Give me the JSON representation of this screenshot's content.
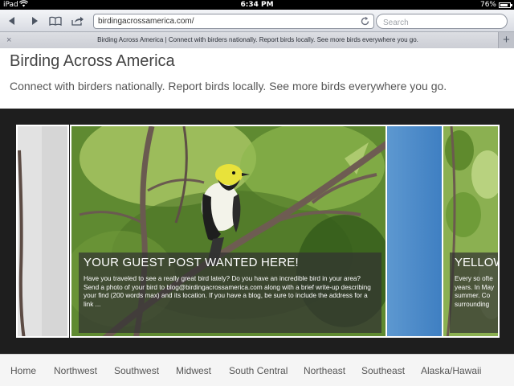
{
  "status_bar": {
    "device": "iPad",
    "time": "6:34 PM",
    "battery": "76%"
  },
  "toolbar": {
    "url": "birdingacrossamerica.com/",
    "search_placeholder": "Search"
  },
  "tab": {
    "title": "Birding Across America | Connect with birders nationally. Report birds locally. See more birds everywhere you go.",
    "close_label": "×",
    "new_tab_label": "+"
  },
  "site": {
    "title": "Birding Across America",
    "tagline": "Connect with birders nationally. Report birds locally. See more birds everywhere you go."
  },
  "slider": {
    "main": {
      "title": "YOUR GUEST POST WANTED HERE!",
      "text": "Have you traveled to see a really great bird lately?  Do you have an incredible bird in your area? Send a photo of your bird to blog@birdingacrossamerica.com along with a brief write-up describing your find (200 words max) and its location.  If you have a blog, be sure to include the address for a link ..."
    },
    "right": {
      "title": "YELLOW",
      "lines": [
        "Every so ofte",
        "years.  In May",
        "summer.  Co",
        "surrounding"
      ]
    }
  },
  "nav": {
    "items": [
      "Home",
      "Northwest",
      "Southwest",
      "Midwest",
      "South Central",
      "Northeast",
      "Southeast",
      "Alaska/Hawaii"
    ]
  },
  "colors": {
    "slider_background": "#1e1e1e",
    "caption_overlay": "rgba(50,50,50,0.72)",
    "nav_background": "#f5f5f5"
  }
}
